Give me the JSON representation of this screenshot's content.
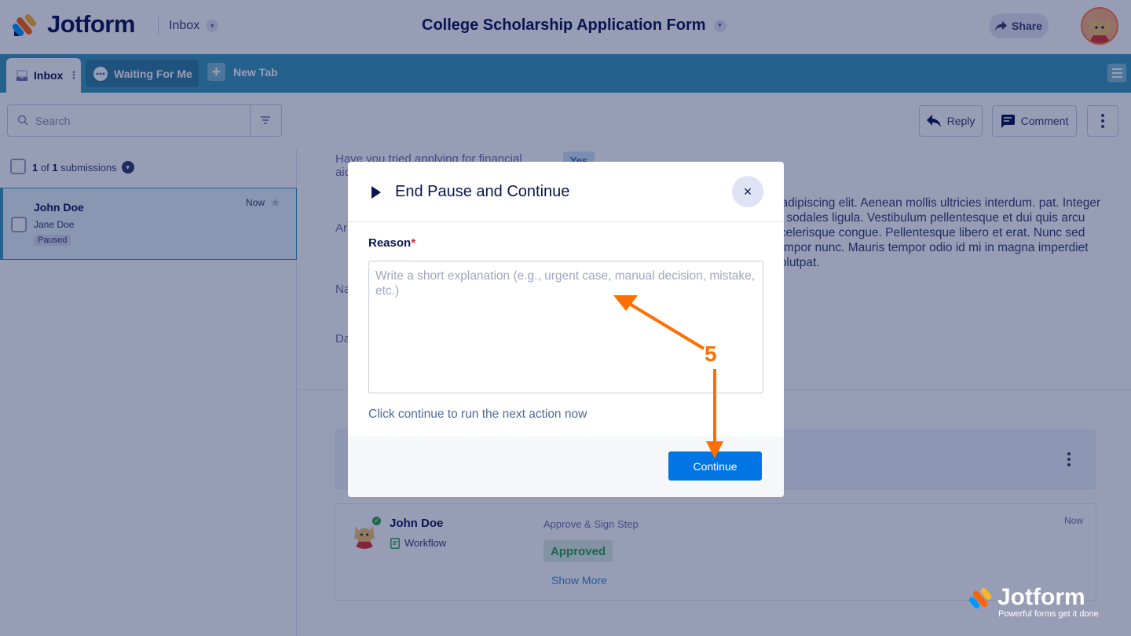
{
  "brand": {
    "name": "Jotform",
    "tagline": "Powerful forms get it done"
  },
  "header": {
    "inbox_label": "Inbox",
    "form_title": "College Scholarship Application Form",
    "share_label": "Share"
  },
  "tabs": [
    {
      "label": "Inbox"
    },
    {
      "label": "Waiting For Me"
    },
    {
      "label": "New Tab"
    }
  ],
  "toolbar": {
    "search_placeholder": "Search",
    "reply_label": "Reply",
    "comment_label": "Comment"
  },
  "list": {
    "count_prefix": "1",
    "count_mid": " of ",
    "count_total": "1",
    "count_suffix": " submissions",
    "items": [
      {
        "name": "John Doe",
        "assignee": "Jane Doe",
        "status": "Paused",
        "time": "Now"
      }
    ]
  },
  "submission": {
    "q_financial": "Have you tried applying for financial aid?",
    "q_financial_answer": "Yes",
    "q_about": "Ar an",
    "q_name": "Na",
    "q_date": "Da",
    "answer_paragraph": "r adipiscing elit. Aenean mollis ultricies interdum. pat. Integer in sodales ligula. Vestibulum pellentesque et dui quis arcu scelerisque congue. Pellentesque libero et erat. Nunc sed tempor nunc. Mauris tempor odio id mi in magna imperdiet volutpat."
  },
  "activity": {
    "name": "John Doe",
    "source": "Workflow",
    "step": "Approve & Sign Step",
    "status": "Approved",
    "time": "Now",
    "show_more": "Show More"
  },
  "modal": {
    "title": "End Pause and Continue",
    "reason_label": "Reason",
    "required_mark": "*",
    "reason_placeholder": "Write a short explanation (e.g., urgent case, manual decision, mistake, etc.)",
    "reason_value": "",
    "hint": "Click continue to run the next action now",
    "continue_label": "Continue",
    "close_glyph": "×"
  },
  "annotation": {
    "step_number": "5",
    "color": "#ff6e00"
  },
  "colors": {
    "tabbar": "#3a98b9",
    "primary_button": "#0075e3",
    "navy": "#0a1551"
  }
}
